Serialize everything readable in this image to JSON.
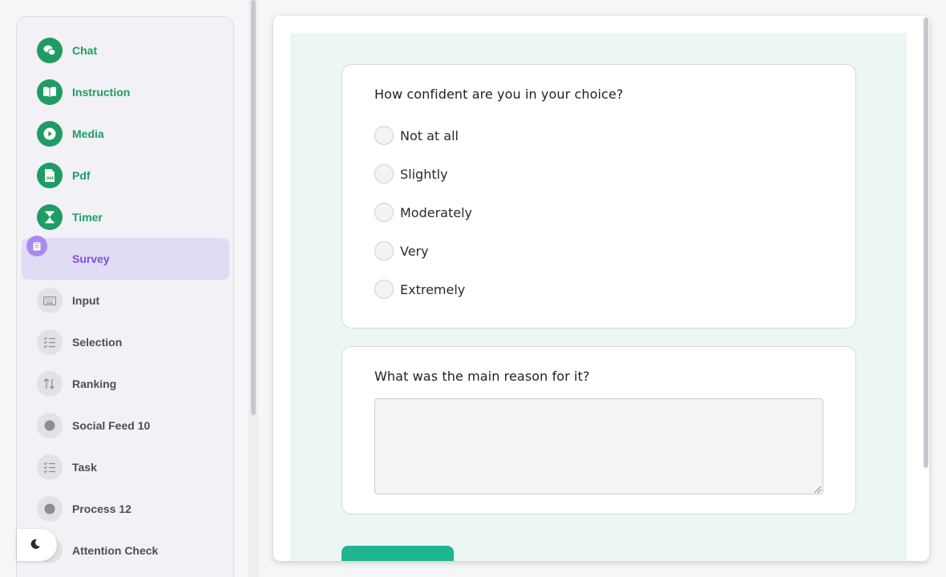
{
  "sidebar": {
    "items": [
      {
        "label": "Chat",
        "icon": "chat-bubbles-icon",
        "state": "done"
      },
      {
        "label": "Instruction",
        "icon": "book-icon",
        "state": "done"
      },
      {
        "label": "Media",
        "icon": "play-icon",
        "state": "done"
      },
      {
        "label": "Pdf",
        "icon": "pdf-file-icon",
        "state": "done"
      },
      {
        "label": "Timer",
        "icon": "hourglass-icon",
        "state": "done"
      },
      {
        "label": "Survey",
        "icon": "clipboard-icon",
        "state": "active"
      },
      {
        "label": "Input",
        "icon": "keyboard-icon",
        "state": "pending"
      },
      {
        "label": "Selection",
        "icon": "checklist-icon",
        "state": "pending"
      },
      {
        "label": "Ranking",
        "icon": "sort-icon",
        "state": "pending"
      },
      {
        "label": "Social Feed 10",
        "icon": "dot-icon",
        "state": "pending"
      },
      {
        "label": "Task",
        "icon": "checklist-icon",
        "state": "pending"
      },
      {
        "label": "Process 12",
        "icon": "dot-icon",
        "state": "pending"
      },
      {
        "label": "Attention Check",
        "icon": "dot-icon",
        "state": "pending"
      }
    ]
  },
  "theme_toggle": {
    "icon": "moon-icon"
  },
  "survey": {
    "q1": {
      "title": "How confident are you in your choice?",
      "options": [
        "Not at all",
        "Slightly",
        "Moderately",
        "Very",
        "Extremely"
      ]
    },
    "q2": {
      "title": "What was the main reason for it?",
      "value": "",
      "placeholder": ""
    },
    "submit_label": ""
  },
  "colors": {
    "done": "#1e9c63",
    "active": "#7c4ee0",
    "active_bg": "#e0dcf5",
    "pending": "#4d4d55",
    "content_bg": "#ecf7f3",
    "button": "#1fb592"
  }
}
